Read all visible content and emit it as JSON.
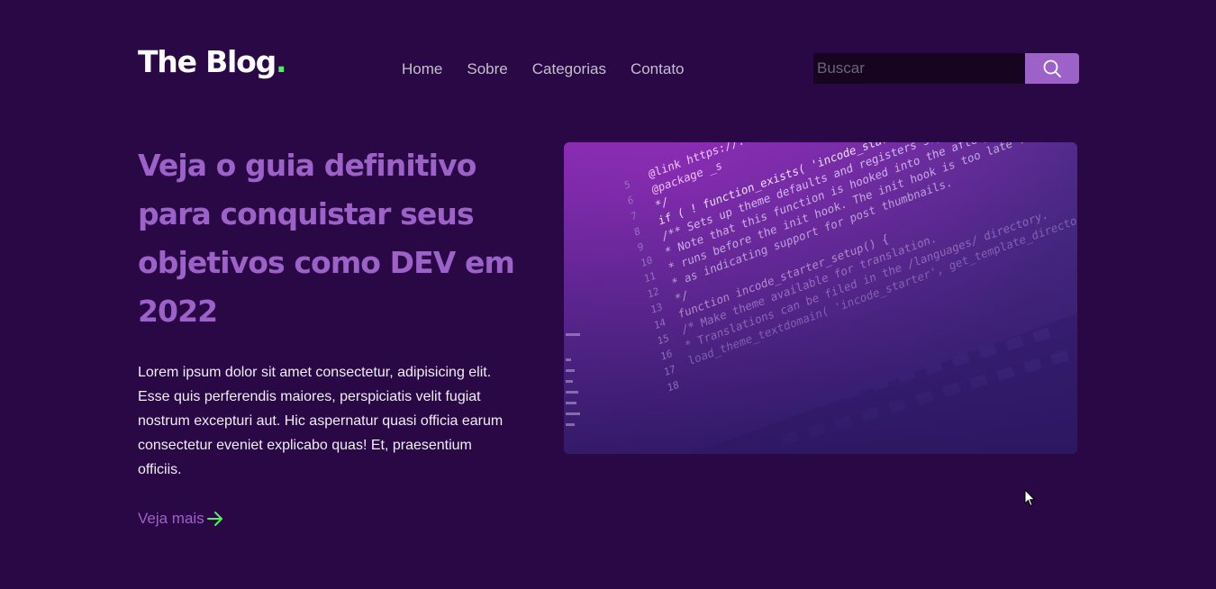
{
  "brand": {
    "name": "The Blog",
    "dot": "."
  },
  "nav": {
    "items": [
      {
        "label": "Home"
      },
      {
        "label": "Sobre"
      },
      {
        "label": "Categorias"
      },
      {
        "label": "Contato"
      }
    ]
  },
  "search": {
    "placeholder": "Buscar",
    "value": "",
    "icon": "search-icon"
  },
  "hero": {
    "title": "Veja o guia definitivo para conquistar seus objetivos como DEV em 2022",
    "text": "Lorem ipsum dolor sit amet consectetur, adipisicing elit. Esse quis perferendis maiores, perspiciatis velit fugiat nostrum excepturi aut. Hic aspernatur quasi officia earum consectetur eveniet explicabo quas! Et, praesentium officiis.",
    "cta_label": "Veja mais",
    "cta_icon": "arrow-right-icon"
  },
  "code_image": {
    "lines": [
      "@link https://...",
      "@package _s",
      "*/",
      "if ( ! function_exists( 'incode_starter_setup' ) ) :",
      "/** Sets up theme defaults and registers support for various WordPress features.",
      " * Note that this function is hooked into the after_setup_theme hook, which",
      " * runs before the init hook. The init hook is too late for some features, such",
      " * as indicating support for post thumbnails.",
      " */",
      "function incode_starter_setup() {",
      "  /* Make theme available for translation.",
      "   * Translations can be filed in the /languages/ directory.",
      "  load_theme_textdomain( 'incode_starter', get_template_directory() . '/languages' );"
    ],
    "line_numbers": [
      "5",
      "6",
      "7",
      "8",
      "9",
      "10",
      "11",
      "12",
      "13",
      "14",
      "15",
      "16",
      "17",
      "18"
    ]
  },
  "colors": {
    "background": "#290845",
    "accent": "#9c62c8",
    "brand_dot": "#4ef05d",
    "arrow": "#4ef05d",
    "search_bg": "#17041f",
    "body_text": "#f1edf4",
    "nav_text": "#c3bfcb"
  }
}
